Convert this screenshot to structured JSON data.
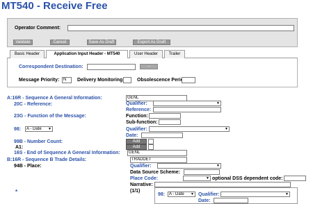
{
  "title": "MT540 - Receive Free",
  "operator": {
    "label": "Operator Comment:",
    "value": "",
    "buttons": [
      "Validate",
      "Cancel",
      "Save As Draft",
      "Export As Draft"
    ]
  },
  "tabs": [
    "Basic Header",
    "Application Input Header - MT540",
    "User Header",
    "Trailer"
  ],
  "app_header": {
    "correspondent_label": "Correspondent Destination:",
    "correspondent_value": "",
    "lookup_button": "...",
    "priority_label": "Message Priority:",
    "priority_value": "N",
    "monitoring_label": "Delivery Monitoring:",
    "monitoring_value": "",
    "obsolescence_label": "Obsolescence Period:",
    "obsolescence_value": ""
  },
  "form": {
    "seq_a_label": "A:16R - Sequence A General Information:",
    "seq_a_value": "GENL",
    "ref20c_label": "20C - Reference:",
    "qualifier_label": "Qualifier:",
    "reference_label": "Reference:",
    "func23g_label": "23G - Function of the Message:",
    "function_label": "Function:",
    "subfunction_label": "Sub-function:",
    "f98_label": "98:",
    "f98_option": "A - Date",
    "f98_qualifier_label": "Qualifier:",
    "f98_date_label": "Date:",
    "num99b_label": "99B - Number Count:",
    "add_label": "Add",
    "a1_label": "A1:",
    "end16s_label": "16S - End of Sequence A General Information:",
    "end16s_value": "GENL",
    "seq_b_label": "B:16R - Sequence B Trade Details:",
    "seq_b_value": "TRADDET",
    "place94b_label": "94B - Place:",
    "place_qualifier_label": "Qualifier:",
    "data_source_label": "Data Source Scheme:",
    "place_code_label": "Place Code:",
    "optional_dss_label": "optional DSS dependent code:",
    "narrative_label": "Narrative:",
    "star": "*",
    "count": "(1/1)",
    "sub_98_label": "98:",
    "sub_98_option": "A - Date",
    "sub_qualifier_label": "Qualifier:",
    "sub_date_label": "Date:"
  }
}
